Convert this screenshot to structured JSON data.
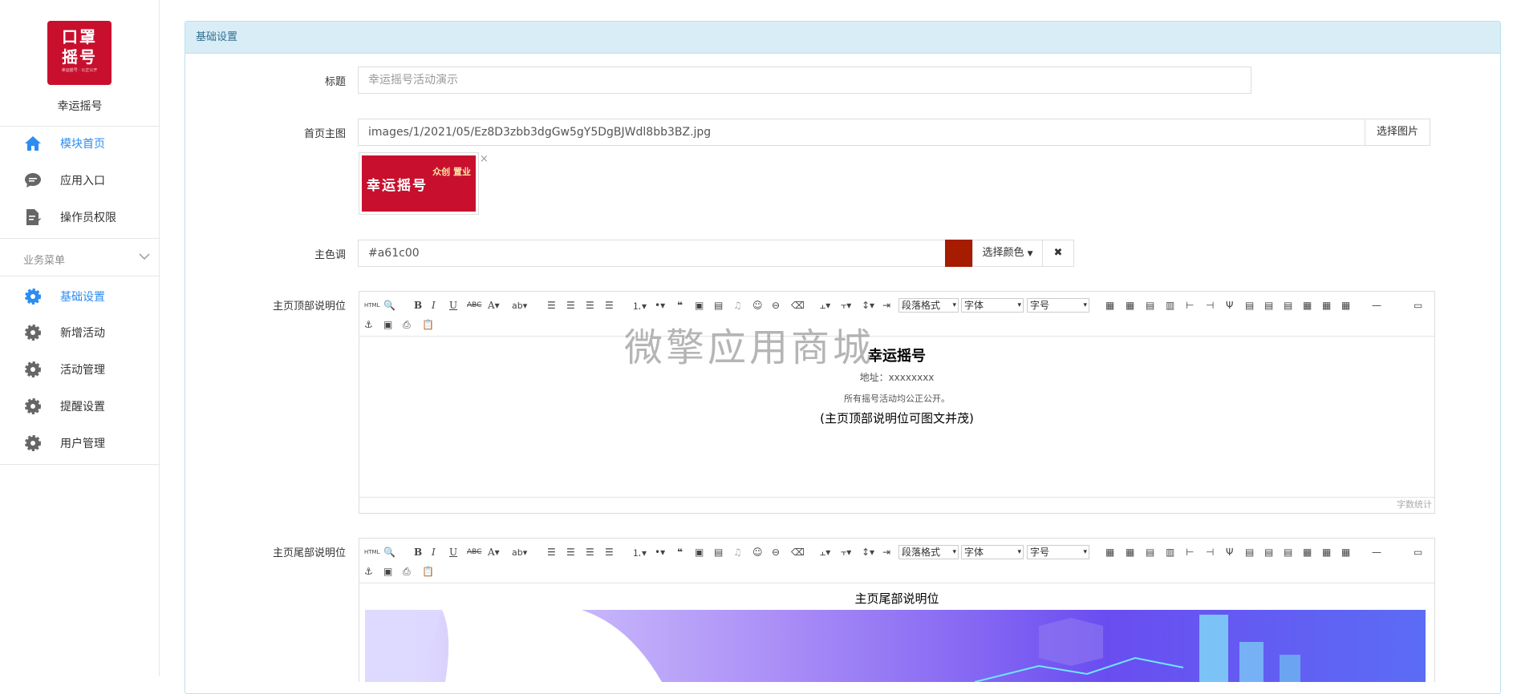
{
  "sidebar": {
    "logo_line1": "口罩",
    "logo_line2": "摇号",
    "logo_small": "幸运摇号 · 公正公开",
    "app_name": "幸运摇号",
    "items": [
      {
        "label": "模块首页",
        "icon": "home-icon"
      },
      {
        "label": "应用入口",
        "icon": "chat-icon"
      },
      {
        "label": "操作员权限",
        "icon": "edit-doc-icon"
      }
    ],
    "group_title": "业务菜单",
    "group_items": [
      {
        "label": "基础设置",
        "icon": "gear-icon"
      },
      {
        "label": "新增活动",
        "icon": "gear-icon"
      },
      {
        "label": "活动管理",
        "icon": "gear-icon"
      },
      {
        "label": "提醒设置",
        "icon": "gear-icon"
      },
      {
        "label": "用户管理",
        "icon": "gear-icon"
      }
    ]
  },
  "panel": {
    "title": "基础设置",
    "title_label": "标题",
    "title_placeholder": "幸运摇号活动演示",
    "image_label": "首页主图",
    "image_value": "images/1/2021/05/Ez8D3zbb3dgGw5gY5DgBJWdl8bb3BZ.jpg",
    "image_button": "选择图片",
    "thumb_text": "幸运摇号",
    "thumb_side": "众创\n置业",
    "thumb_remove": "×",
    "color_label": "主色调",
    "color_value": "#a61c00",
    "color_button": "选择颜色",
    "color_clear": "✖",
    "top_label": "主页顶部说明位",
    "bottom_label": "主页尾部说明位"
  },
  "editor": {
    "sel_para": "段落格式",
    "sel_font": "字体",
    "sel_size": "字号",
    "wordcount": "字数统计"
  },
  "top_content": {
    "heading": "幸运摇号",
    "address": "地址：xxxxxxxx",
    "note": "所有摇号活动均公正公开。",
    "caption": "(主页顶部说明位可图文并茂)"
  },
  "bottom_content": {
    "heading": "主页尾部说明位"
  },
  "watermark": "微擎应用商城",
  "colors": {
    "accent": "#2d8cf0",
    "brand": "#c8102e",
    "main_color": "#a61c00",
    "panel_head": "#d9edf7"
  }
}
